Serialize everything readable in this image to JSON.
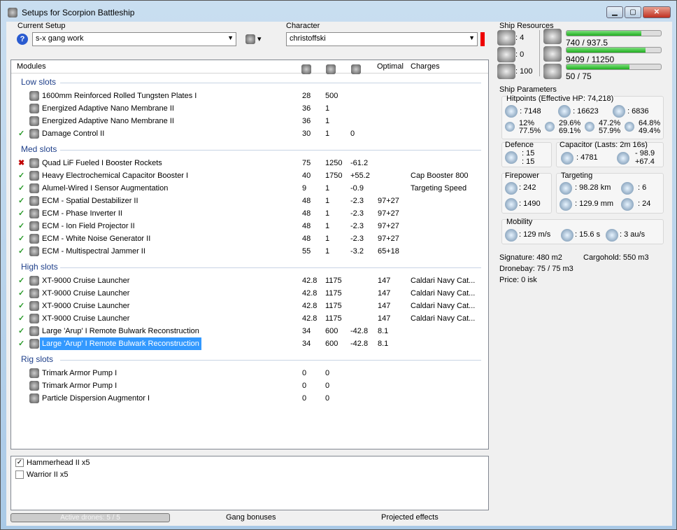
{
  "window": {
    "title": "Setups for Scorpion Battleship",
    "buttons": [
      "▁",
      "▢",
      "✕"
    ]
  },
  "setup": {
    "label": "Current Setup",
    "value": "s-x gang work"
  },
  "character": {
    "label": "Character",
    "value": "christoffski"
  },
  "table": {
    "headers": {
      "modules": "Modules",
      "optimal": "Optimal",
      "charges": "Charges"
    },
    "sections": [
      {
        "title": "Low slots",
        "rows": [
          {
            "status": "",
            "name": "1600mm Reinforced Rolled Tungsten Plates I",
            "c1": "28",
            "c2": "500",
            "c3": "",
            "optimal": "",
            "charges": ""
          },
          {
            "status": "",
            "name": "Energized Adaptive Nano Membrane II",
            "c1": "36",
            "c2": "1",
            "c3": "",
            "optimal": "",
            "charges": ""
          },
          {
            "status": "",
            "name": "Energized Adaptive Nano Membrane II",
            "c1": "36",
            "c2": "1",
            "c3": "",
            "optimal": "",
            "charges": ""
          },
          {
            "status": "ok",
            "name": "Damage Control II",
            "c1": "30",
            "c2": "1",
            "c3": "0",
            "optimal": "",
            "charges": ""
          }
        ]
      },
      {
        "title": "Med slots",
        "rows": [
          {
            "status": "err",
            "name": "Quad LiF Fueled I Booster Rockets",
            "c1": "75",
            "c2": "1250",
            "c3": "-61.2",
            "optimal": "",
            "charges": ""
          },
          {
            "status": "ok",
            "name": "Heavy Electrochemical Capacitor Booster I",
            "c1": "40",
            "c2": "1750",
            "c3": "+55.2",
            "optimal": "",
            "charges": "Cap Booster 800"
          },
          {
            "status": "ok",
            "name": "Alumel-Wired I Sensor Augmentation",
            "c1": "9",
            "c2": "1",
            "c3": "-0.9",
            "optimal": "",
            "charges": "Targeting Speed"
          },
          {
            "status": "ok",
            "name": "ECM - Spatial Destabilizer II",
            "c1": "48",
            "c2": "1",
            "c3": "-2.3",
            "optimal": "97+27",
            "charges": ""
          },
          {
            "status": "ok",
            "name": "ECM - Phase Inverter II",
            "c1": "48",
            "c2": "1",
            "c3": "-2.3",
            "optimal": "97+27",
            "charges": ""
          },
          {
            "status": "ok",
            "name": "ECM - Ion Field Projector II",
            "c1": "48",
            "c2": "1",
            "c3": "-2.3",
            "optimal": "97+27",
            "charges": ""
          },
          {
            "status": "ok",
            "name": "ECM - White Noise Generator II",
            "c1": "48",
            "c2": "1",
            "c3": "-2.3",
            "optimal": "97+27",
            "charges": ""
          },
          {
            "status": "ok",
            "name": "ECM - Multispectral Jammer II",
            "c1": "55",
            "c2": "1",
            "c3": "-3.2",
            "optimal": "65+18",
            "charges": ""
          }
        ]
      },
      {
        "title": "High slots",
        "rows": [
          {
            "status": "ok",
            "name": "XT-9000 Cruise Launcher",
            "c1": "42.8",
            "c2": "1175",
            "c3": "",
            "optimal": "147",
            "charges": "Caldari Navy Cat..."
          },
          {
            "status": "ok",
            "name": "XT-9000 Cruise Launcher",
            "c1": "42.8",
            "c2": "1175",
            "c3": "",
            "optimal": "147",
            "charges": "Caldari Navy Cat..."
          },
          {
            "status": "ok",
            "name": "XT-9000 Cruise Launcher",
            "c1": "42.8",
            "c2": "1175",
            "c3": "",
            "optimal": "147",
            "charges": "Caldari Navy Cat..."
          },
          {
            "status": "ok",
            "name": "XT-9000 Cruise Launcher",
            "c1": "42.8",
            "c2": "1175",
            "c3": "",
            "optimal": "147",
            "charges": "Caldari Navy Cat..."
          },
          {
            "status": "ok",
            "name": "Large 'Arup' I Remote Bulwark Reconstruction",
            "c1": "34",
            "c2": "600",
            "c3": "-42.8",
            "optimal": "8.1",
            "charges": ""
          },
          {
            "status": "ok",
            "name": "Large 'Arup' I Remote Bulwark Reconstruction",
            "c1": "34",
            "c2": "600",
            "c3": "-42.8",
            "optimal": "8.1",
            "charges": "",
            "selected": true
          }
        ]
      },
      {
        "title": "Rig slots",
        "rows": [
          {
            "status": "",
            "name": "Trimark Armor Pump I",
            "c1": "0",
            "c2": "0",
            "c3": "",
            "optimal": "",
            "charges": ""
          },
          {
            "status": "",
            "name": "Trimark Armor Pump I",
            "c1": "0",
            "c2": "0",
            "c3": "",
            "optimal": "",
            "charges": ""
          },
          {
            "status": "",
            "name": "Particle Dispersion Augmentor I",
            "c1": "0",
            "c2": "0",
            "c3": "",
            "optimal": "",
            "charges": ""
          }
        ]
      }
    ]
  },
  "drones": [
    {
      "name": "Hammerhead II x5",
      "checked": true
    },
    {
      "name": "Warrior II x5",
      "checked": false
    }
  ],
  "bottom": {
    "active_drones": "Active drones: 5 / 5",
    "gang": "Gang bonuses",
    "projected": "Projected effects"
  },
  "resources": {
    "title": "Ship Resources",
    "turrets": ": 4",
    "launchers": ": 0",
    "calibration": ": 100",
    "cpu": {
      "text": "740 / 937.5",
      "fraction": 0.79
    },
    "power": {
      "text": "9409 / 11250",
      "fraction": 0.84
    },
    "drone_bw": {
      "text": "50 / 75",
      "fraction": 0.67
    }
  },
  "params": {
    "title": "Ship Parameters",
    "hp_title": "Hitpoints (Effective HP: 74,218)",
    "shield": ": 7148",
    "armor": ": 16623",
    "structure": ": 6836",
    "res": [
      [
        "12%",
        "77.5%"
      ],
      [
        "29.6%",
        "69.1%"
      ],
      [
        "47.2%",
        "57.9%"
      ],
      [
        "64.8%",
        "49.4%"
      ]
    ],
    "defence_title": "Defence",
    "def1": ": 15",
    "def2": ": 15",
    "cap_title": "Capacitor (Lasts: 2m 16s)",
    "cap": ": 4781",
    "cap_use": "- 98.9",
    "cap_regen": "+67.4",
    "fire_title": "Firepower",
    "dps": ": 242",
    "volley": ": 1490",
    "tgt_title": "Targeting",
    "range": ": 98.28 km",
    "targets": ": 6",
    "scan": ": 129.9 mm",
    "sensor": ": 24",
    "mob_title": "Mobility",
    "speed": ": 129 m/s",
    "align": ": 15.6 s",
    "warp": ": 3 au/s",
    "signature": "Signature: 480 m2",
    "cargo": "Cargohold: 550 m3",
    "dronebay": "Dronebay: 75 / 75 m3",
    "price": "Price: 0 isk"
  },
  "colors": {
    "ok": "#2a9a2a",
    "err": "#c00000",
    "selection": "#3399ff",
    "bar": "#1fae1f"
  }
}
